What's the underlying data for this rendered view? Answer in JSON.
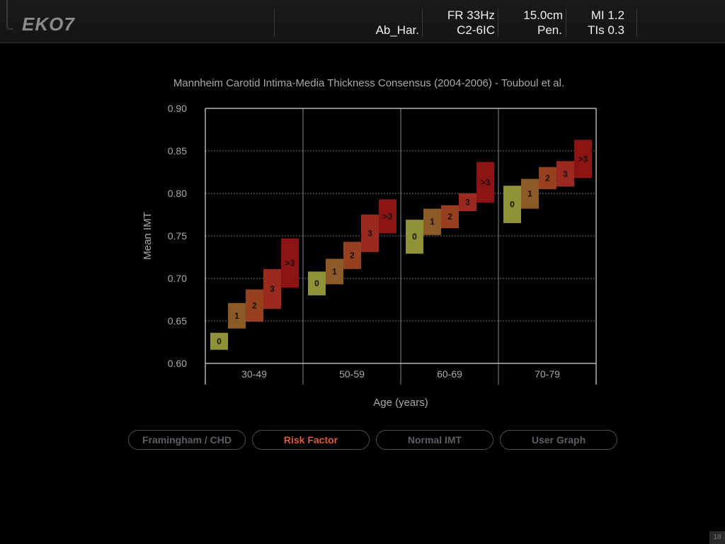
{
  "header": {
    "logo": "EKO7",
    "preset": "Ab_Har.",
    "frame_rate": "FR 33Hz",
    "probe": "C2-6IC",
    "depth": "15.0cm",
    "depth_label": "Pen.",
    "mi": "MI 1.2",
    "tis": "TIs 0.3"
  },
  "chart_data": {
    "type": "bar",
    "title": "Mannheim Carotid Intima-Media Thickness Consensus (2004-2006) - Touboul et al.",
    "xlabel": "Age (years)",
    "ylabel": "Mean IMT",
    "ylim": [
      0.6,
      0.9
    ],
    "yticks": [
      0.6,
      0.65,
      0.7,
      0.75,
      0.8,
      0.85,
      0.9
    ],
    "ytick_labels": [
      "0.60",
      "0.65",
      "0.70",
      "0.75",
      "0.80",
      "0.85",
      "0.90"
    ],
    "grid": true,
    "categories": [
      "30-49",
      "50-59",
      "60-69",
      "70-79"
    ],
    "risk_levels": [
      "0",
      "1",
      "2",
      "3",
      ">3"
    ],
    "level_colors": [
      "#8f9236",
      "#8c5a26",
      "#96401e",
      "#9a2a20",
      "#8c1414"
    ],
    "series": [
      {
        "values": [
          [
            0.616,
            0.636
          ],
          [
            0.641,
            0.671
          ],
          [
            0.649,
            0.687
          ],
          [
            0.664,
            0.711
          ],
          [
            0.689,
            0.747
          ]
        ]
      },
      {
        "values": [
          [
            0.68,
            0.708
          ],
          [
            0.693,
            0.723
          ],
          [
            0.711,
            0.743
          ],
          [
            0.731,
            0.775
          ],
          [
            0.753,
            0.793
          ]
        ]
      },
      {
        "values": [
          [
            0.729,
            0.769
          ],
          [
            0.751,
            0.782
          ],
          [
            0.759,
            0.786
          ],
          [
            0.779,
            0.8
          ],
          [
            0.789,
            0.837
          ]
        ]
      },
      {
        "values": [
          [
            0.765,
            0.809
          ],
          [
            0.782,
            0.817
          ],
          [
            0.805,
            0.831
          ],
          [
            0.808,
            0.838
          ],
          [
            0.818,
            0.863
          ]
        ]
      }
    ]
  },
  "tabs": [
    {
      "label": "Framingham / CHD",
      "active": false
    },
    {
      "label": "Risk Factor",
      "active": true
    },
    {
      "label": "Normal IMT",
      "active": false
    },
    {
      "label": "User Graph",
      "active": false
    }
  ],
  "footer": {
    "page_number": "18"
  }
}
